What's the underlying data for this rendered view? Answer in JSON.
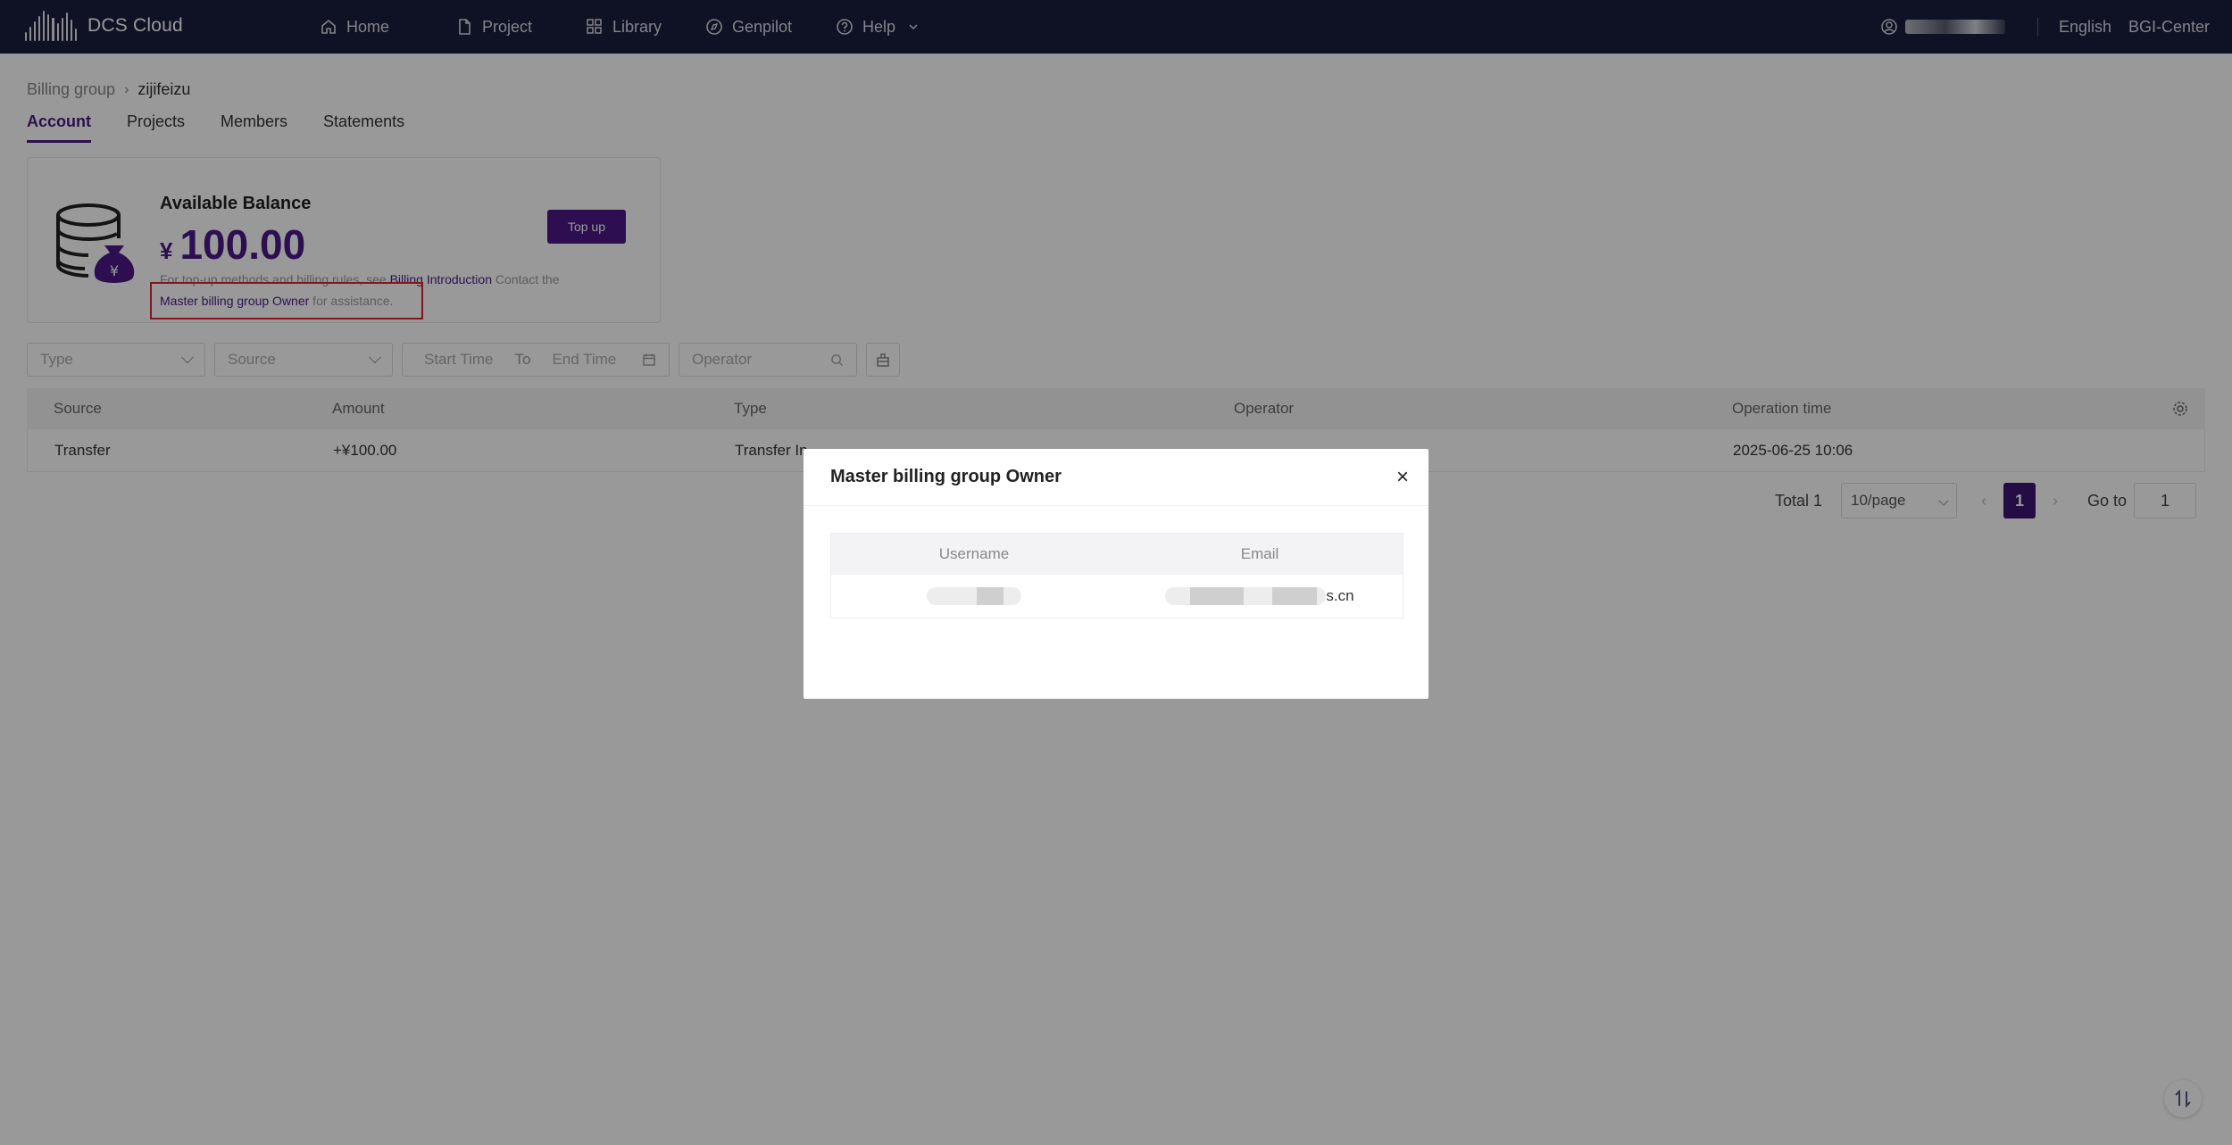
{
  "app": {
    "logo_text": "DCS Cloud"
  },
  "nav": {
    "items": [
      {
        "label": "Home",
        "icon": "home-icon"
      },
      {
        "label": "Project",
        "icon": "document-icon"
      },
      {
        "label": "Library",
        "icon": "grid-icon"
      },
      {
        "label": "Genpilot",
        "icon": "compass-icon"
      },
      {
        "label": "Help",
        "icon": "help-circle-icon"
      }
    ],
    "language": "English",
    "org": "BGI-Center"
  },
  "breadcrumb": {
    "parent": "Billing group",
    "current": "zijifeizu"
  },
  "tabs": [
    "Account",
    "Projects",
    "Members",
    "Statements"
  ],
  "balance": {
    "title": "Available Balance",
    "currency": "¥",
    "amount": "100.00",
    "desc_prefix": "For top-up methods and billing rules, see ",
    "desc_link": "Billing Introduction",
    "desc_mid": " Contact the ",
    "owner_link": "Master billing group Owner",
    "desc_suffix": " for assistance.",
    "topup_label": "Top up"
  },
  "filters": {
    "type_placeholder": "Type",
    "source_placeholder": "Source",
    "start_placeholder": "Start Time",
    "to_label": "To",
    "end_placeholder": "End Time",
    "operator_placeholder": "Operator"
  },
  "table": {
    "headers": [
      "Source",
      "Amount",
      "Type",
      "Operator",
      "Operation time"
    ],
    "rows": [
      {
        "source": "Transfer",
        "amount": "+¥100.00",
        "type": "Transfer In",
        "operator": "",
        "time": "2025-06-25 10:06"
      }
    ]
  },
  "pager": {
    "total": "Total 1",
    "page_size": "10/page",
    "current": "1",
    "goto_label": "Go to",
    "goto_value": "1"
  },
  "modal": {
    "title": "Master billing group Owner",
    "close": "×",
    "headers": [
      "Username",
      "Email"
    ],
    "email_suffix": "s.cn"
  }
}
